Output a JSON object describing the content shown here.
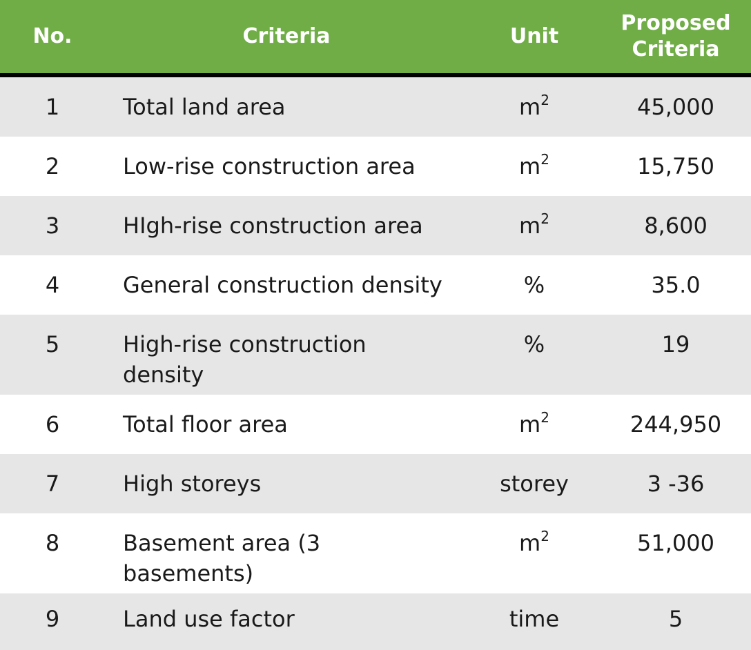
{
  "header": {
    "no": "No.",
    "criteria": "Criteria",
    "unit": "Unit",
    "proposed_line1": "Proposed",
    "proposed_line2": "Criteria"
  },
  "rows": [
    {
      "no": "1",
      "criteria": "Total land area",
      "unit_base": "m",
      "unit_sup": "2",
      "value": "45,000"
    },
    {
      "no": "2",
      "criteria": "Low-rise construction area",
      "unit_base": "m",
      "unit_sup": "2",
      "value": "15,750"
    },
    {
      "no": "3",
      "criteria": "HIgh-rise construction area",
      "unit_base": "m",
      "unit_sup": "2",
      "value": "8,600"
    },
    {
      "no": "4",
      "criteria": "General construction density",
      "unit_base": "%",
      "unit_sup": "",
      "value": "35.0"
    },
    {
      "no": "5",
      "criteria_line1": "High-rise construction",
      "criteria_line2": "density",
      "unit_base": "%",
      "unit_sup": "",
      "value": "19"
    },
    {
      "no": "6",
      "criteria": "Total floor area",
      "unit_base": "m",
      "unit_sup": "2",
      "value": "244,950"
    },
    {
      "no": "7",
      "criteria": "High storeys",
      "unit_base": "storey",
      "unit_sup": "",
      "value": "3 -36"
    },
    {
      "no": "8",
      "criteria_line1": "Basement area (3",
      "criteria_line2": "basements)",
      "unit_base": "m",
      "unit_sup": "2",
      "value": "51,000"
    },
    {
      "no": "9",
      "criteria": "Land use factor",
      "unit_base": "time",
      "unit_sup": "",
      "value": "5"
    }
  ],
  "colors": {
    "header_bg": "#70ad47",
    "row_alt_bg": "#e7e6e6",
    "row_bg": "#ffffff"
  }
}
